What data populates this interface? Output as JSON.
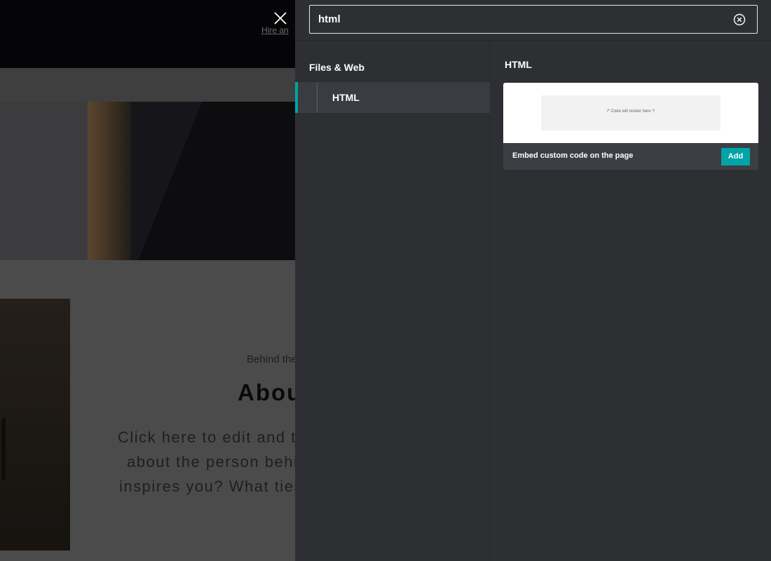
{
  "background": {
    "header_link": "Hire an",
    "behind": "Behind the",
    "about_title": "About",
    "paragraph_lines": [
      "Click here to edit and t",
      "about the person behi",
      "inspires you? What ties"
    ]
  },
  "search": {
    "value": "html"
  },
  "categories": {
    "section_title": "Files & Web",
    "items": [
      {
        "label": "HTML"
      }
    ]
  },
  "results": {
    "title": "HTML",
    "cards": [
      {
        "preview_text": "/* Code will render here */",
        "description": "Embed custom code on the page",
        "add_label": "Add"
      }
    ]
  },
  "colors": {
    "accent": "#00a4a6",
    "panel_bg": "#2d2f33",
    "selected_bg": "#3a3c41"
  },
  "icons": {
    "close": "close-icon",
    "clear_search": "clear-circle-x-icon"
  }
}
